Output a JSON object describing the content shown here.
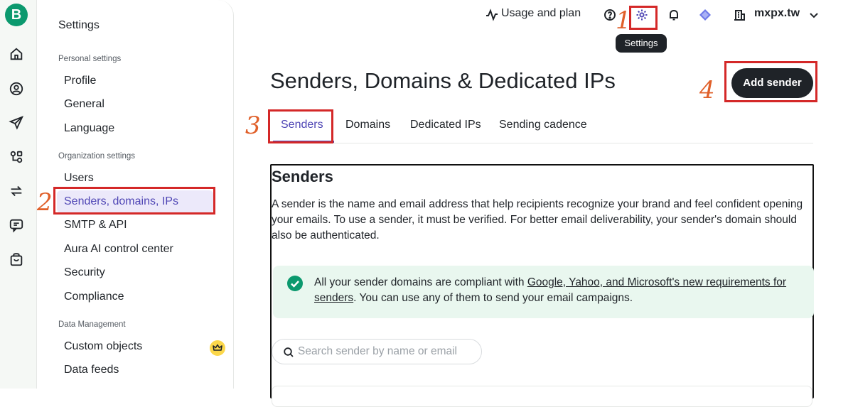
{
  "app": {
    "logo_letter": "B"
  },
  "rail": {
    "icons": [
      "home-icon",
      "contacts-icon",
      "campaigns-icon",
      "automations-icon",
      "transactional-icon",
      "conversations-icon",
      "sales-icon"
    ]
  },
  "sidebar": {
    "title": "Settings",
    "personal_heading": "Personal settings",
    "personal_items": [
      "Profile",
      "General",
      "Language"
    ],
    "org_heading": "Organization settings",
    "org_items": [
      "Users",
      "Senders, domains, IPs",
      "SMTP & API",
      "Aura AI control center",
      "Security",
      "Compliance"
    ],
    "data_heading": "Data Management",
    "data_items": [
      "Custom objects",
      "Data feeds"
    ],
    "active_item": "Senders, domains, IPs"
  },
  "topbar": {
    "usage_label": "Usage and plan",
    "account_name": "mxpx.tw",
    "settings_tooltip": "Settings"
  },
  "main": {
    "title": "Senders, Domains & Dedicated IPs",
    "add_button": "Add sender",
    "tabs": [
      "Senders",
      "Domains",
      "Dedicated IPs",
      "Sending cadence"
    ],
    "active_tab": "Senders",
    "card": {
      "title": "Senders",
      "description": "A sender is the name and email address that help recipients recognize your brand and feel confident opening your emails. To use a sender, it must be verified. For better email deliverability, your sender's domain should also be authenticated.",
      "banner_prefix": "All your sender domains are compliant with ",
      "banner_link": "Google, Yahoo, and Microsoft's new requirements for senders",
      "banner_suffix": ". You can use any of them to send your email campaigns.",
      "search_placeholder": "Search sender by name or email"
    }
  },
  "annotations": [
    "1",
    "2",
    "3",
    "4"
  ],
  "colors": {
    "accent": "#4f46b5",
    "brand": "#0b996e",
    "annotation": "#d42828"
  }
}
